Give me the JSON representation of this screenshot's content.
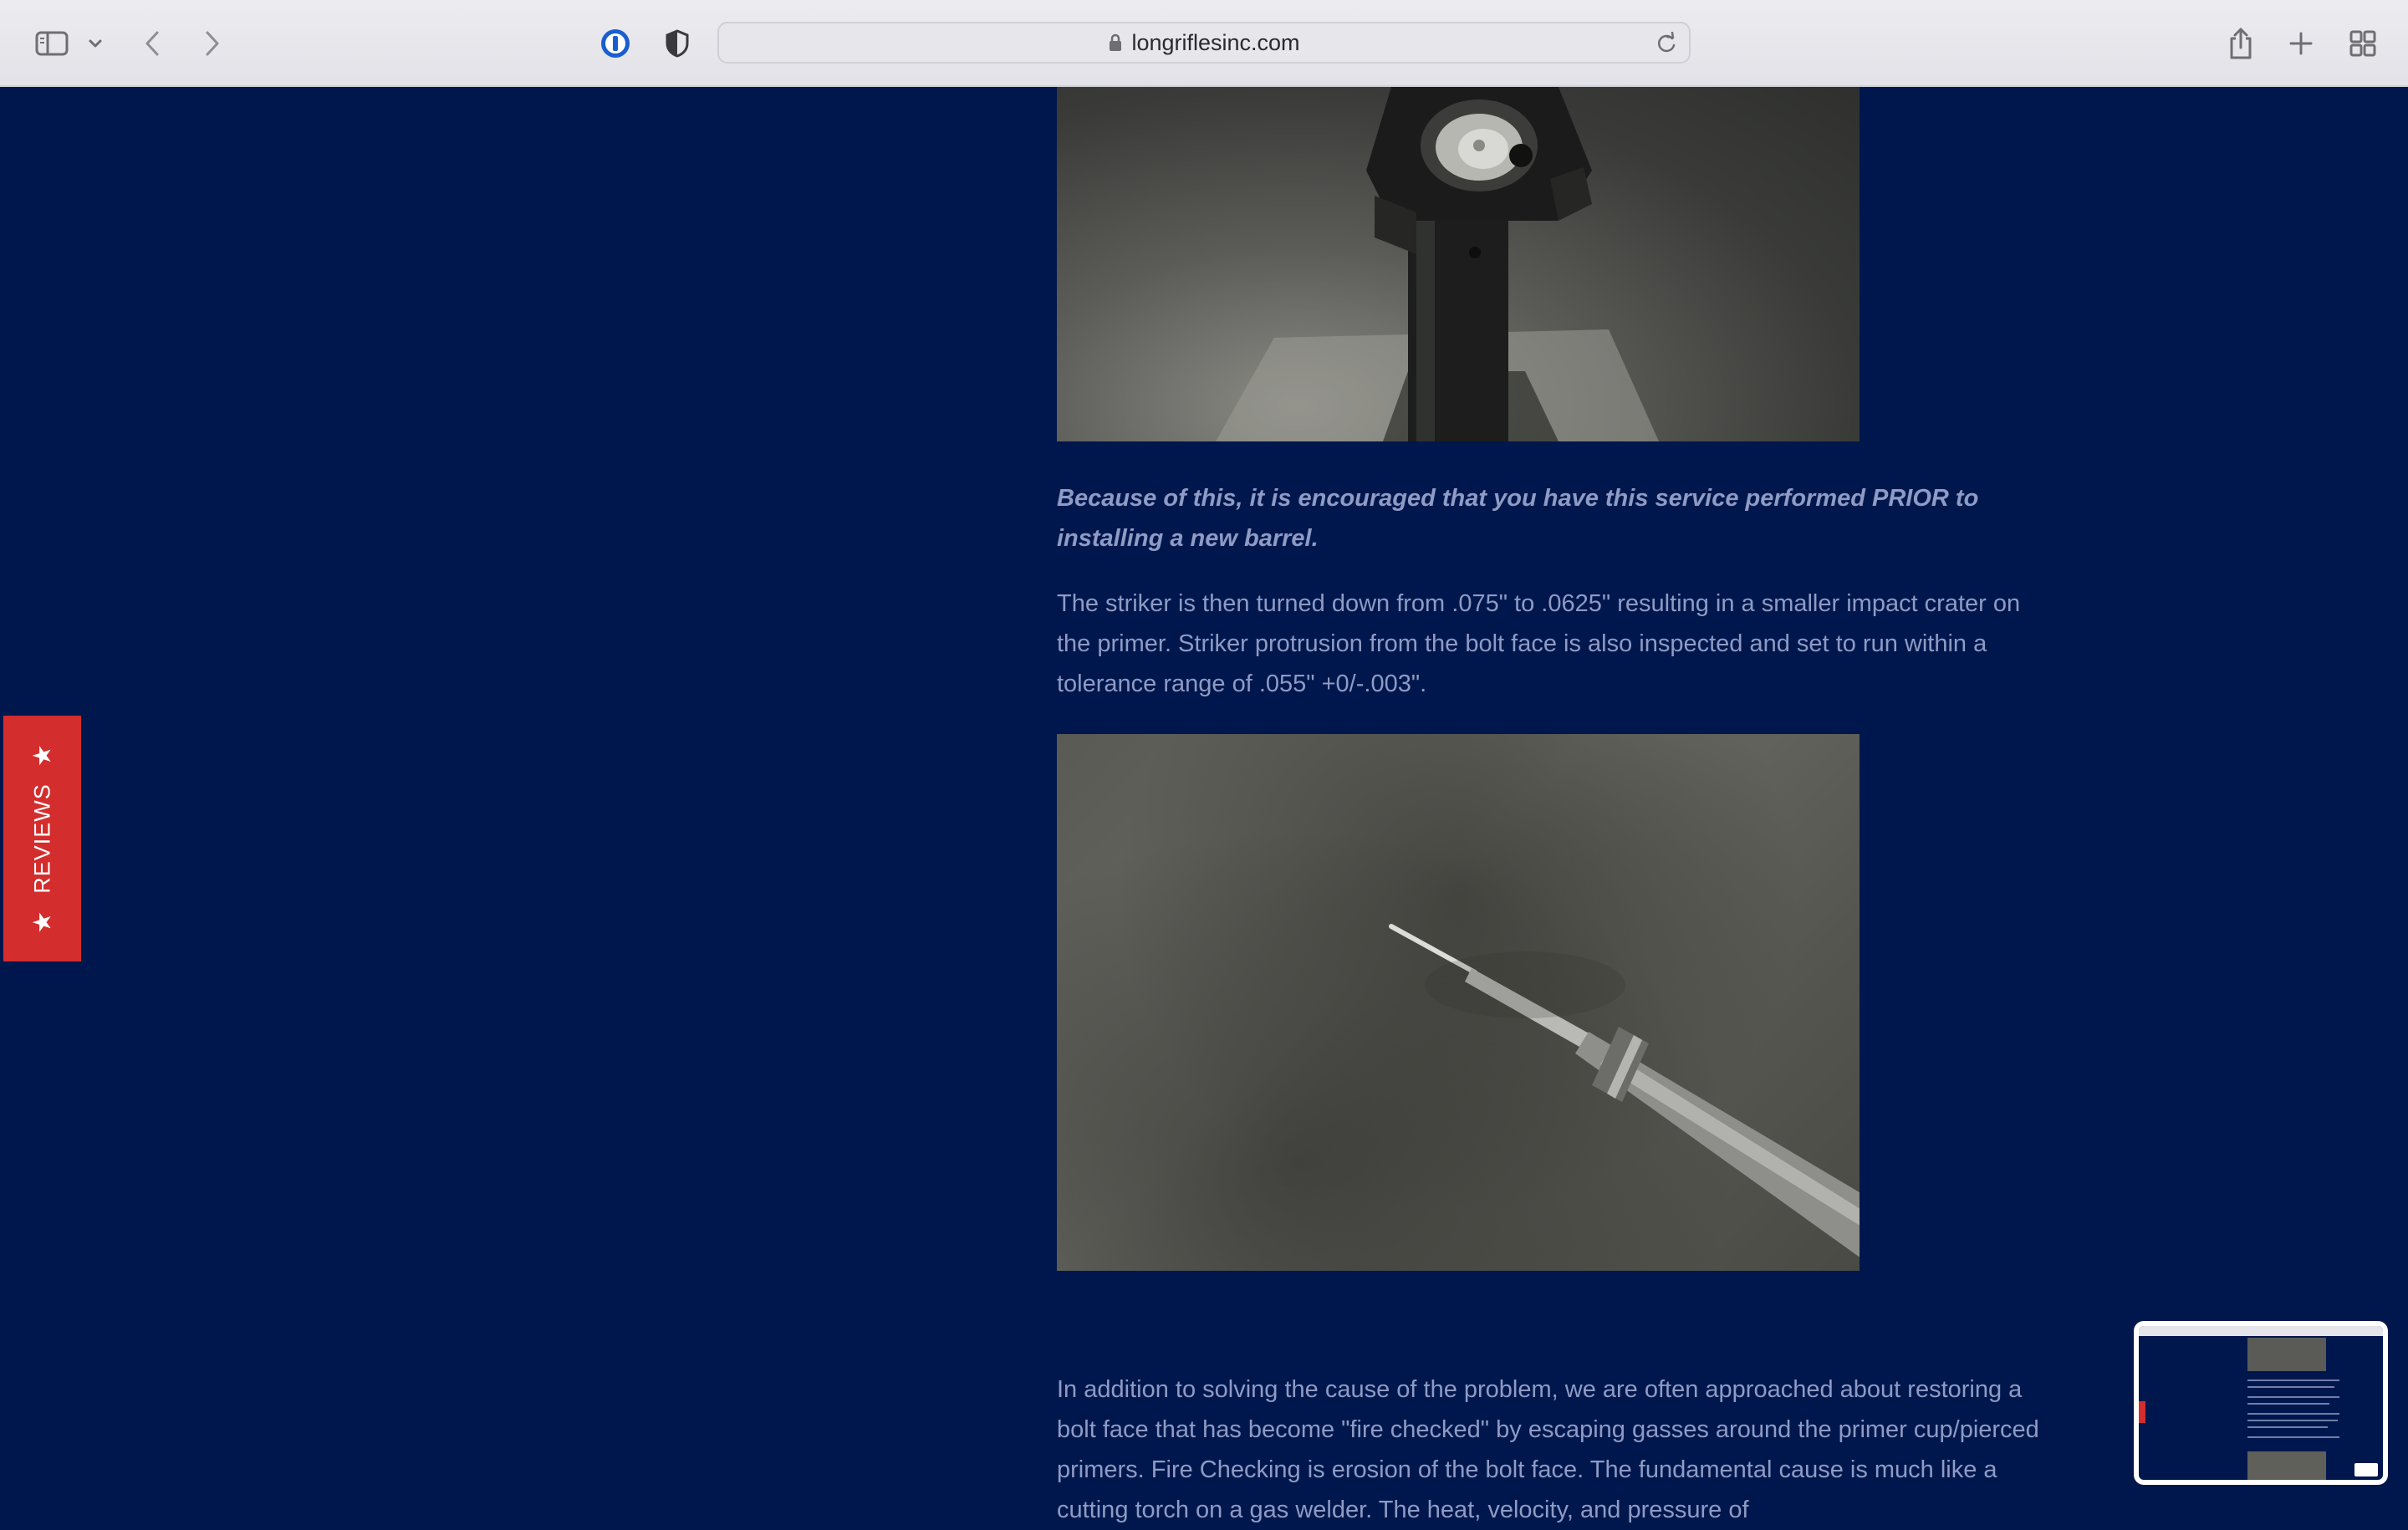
{
  "browser": {
    "url": "longriflesinc.com",
    "icons": {
      "sidebar": "sidebar-icon",
      "chevron": "chevron-down-icon",
      "back": "back-icon",
      "forward": "forward-icon",
      "password": "password-manager-icon",
      "shield": "privacy-shield-icon",
      "lock": "lock-icon",
      "reload": "reload-icon",
      "share": "share-icon",
      "new_tab": "plus-icon",
      "tab_overview": "tab-grid-icon"
    }
  },
  "article": {
    "emphasis": "Because of this, it is encouraged that you have this service performed  PRIOR to installing a new barrel.",
    "paragraph_striker": "The striker is then turned down from .075\" to .0625\" resulting in a smaller impact crater on the primer.  Striker protrusion from the bolt face is also inspected and set to run within a tolerance range of .055\" +0/-.003\".",
    "paragraph_fire_checking": " In addition to solving the cause of the problem, we are often approached about restoring a bolt face that has become \"fire checked\" by escaping gasses around the primer cup/pierced primers.  Fire Checking is erosion of the bolt face.  The fundamental cause is much like a cutting torch on a gas welder.  The heat, velocity, and pressure of"
  },
  "reviews_tab": {
    "label": "REVIEWS",
    "color": "#d42d2d"
  },
  "colors": {
    "page_background": "#00174d",
    "body_text": "#8e9bc4"
  }
}
